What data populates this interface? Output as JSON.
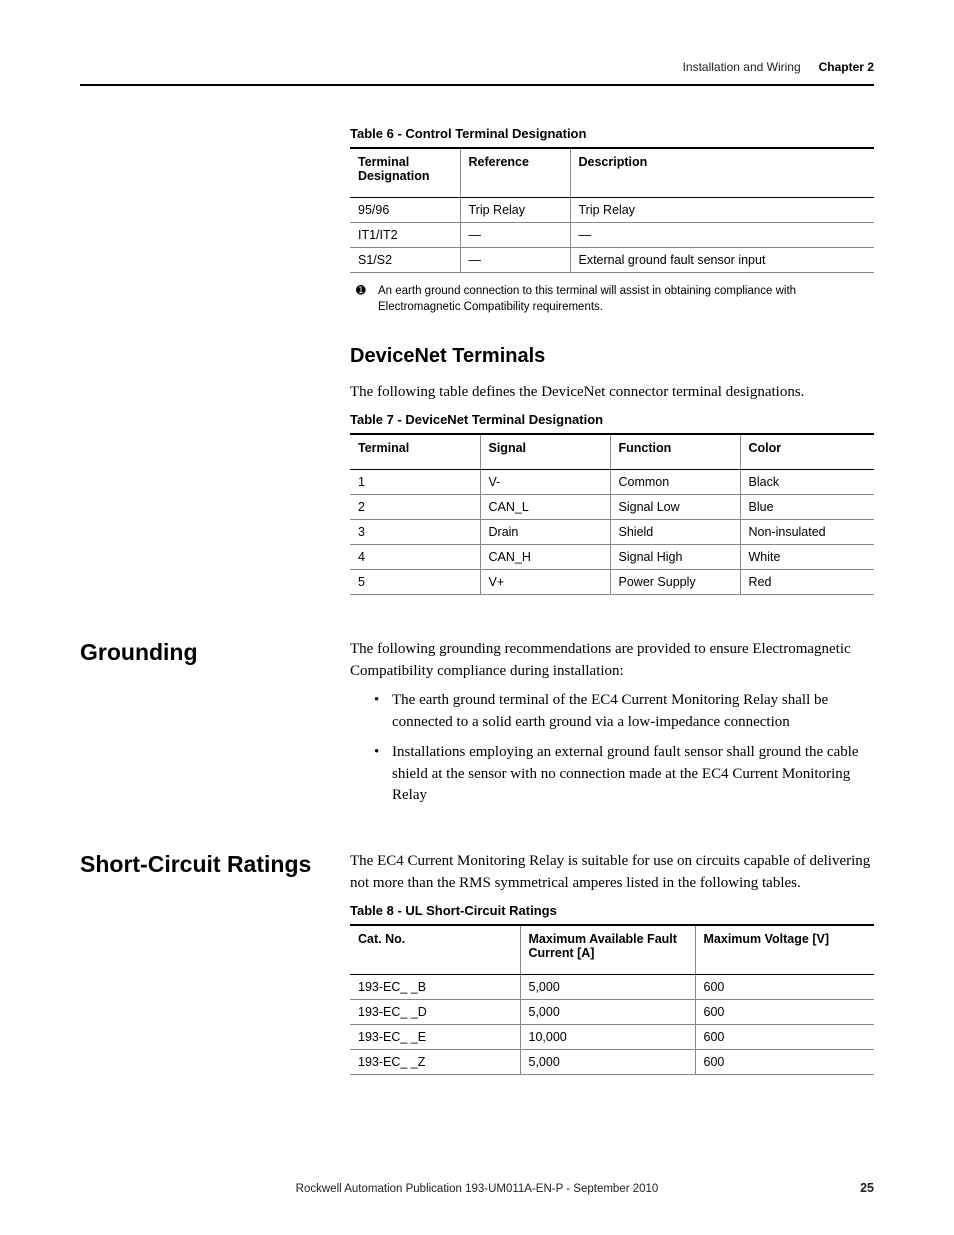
{
  "header": {
    "section": "Installation and Wiring",
    "chapter": "Chapter 2"
  },
  "table6": {
    "caption": "Table 6 - Control Terminal Designation",
    "headers": [
      "Terminal Designation",
      "Reference",
      "Description"
    ],
    "rows": [
      [
        "95/96",
        "Trip Relay",
        "Trip Relay"
      ],
      [
        "IT1/IT2",
        "—",
        "—"
      ],
      [
        "S1/S2",
        "—",
        "External ground fault sensor input"
      ]
    ]
  },
  "footnote1": {
    "marker": "➊",
    "text": "An earth ground connection to this terminal will assist in obtaining compliance with Electromagnetic Compatibility requirements."
  },
  "devicenet": {
    "heading": "DeviceNet Terminals",
    "intro": "The following table defines the DeviceNet connector terminal designations."
  },
  "table7": {
    "caption": "Table 7 - DeviceNet Terminal Designation",
    "headers": [
      "Terminal",
      "Signal",
      "Function",
      "Color"
    ],
    "rows": [
      [
        "1",
        "V-",
        "Common",
        "Black"
      ],
      [
        "2",
        "CAN_L",
        "Signal Low",
        "Blue"
      ],
      [
        "3",
        "Drain",
        "Shield",
        "Non-insulated"
      ],
      [
        "4",
        "CAN_H",
        "Signal High",
        "White"
      ],
      [
        "5",
        "V+",
        "Power Supply",
        "Red"
      ]
    ]
  },
  "grounding": {
    "heading": "Grounding",
    "intro": "The following grounding recommendations are provided to ensure Electromagnetic Compatibility compliance during installation:",
    "bullets": [
      "The earth ground terminal of the EC4 Current Monitoring Relay shall be connected to a solid earth ground via a low-impedance connection",
      "Installations employing an external ground fault sensor shall ground the cable shield at the sensor with no connection made at the EC4 Current Monitoring Relay"
    ]
  },
  "short_circuit": {
    "heading": "Short-Circuit Ratings",
    "intro": "The EC4 Current Monitoring Relay is suitable for use on circuits capable of delivering not more than the RMS symmetrical amperes listed in the following tables."
  },
  "table8": {
    "caption": "Table 8 - UL Short-Circuit Ratings",
    "headers": [
      "Cat. No.",
      "Maximum Available Fault Current [A]",
      "Maximum Voltage [V]"
    ],
    "rows": [
      [
        "193-EC_ _B",
        "5,000",
        "600"
      ],
      [
        "193-EC_ _D",
        "5,000",
        "600"
      ],
      [
        "193-EC_ _E",
        "10,000",
        "600"
      ],
      [
        "193-EC_ _Z",
        "5,000",
        "600"
      ]
    ]
  },
  "footer": {
    "text": "Rockwell Automation Publication 193-UM011A-EN-P - September 2010",
    "page": "25"
  }
}
